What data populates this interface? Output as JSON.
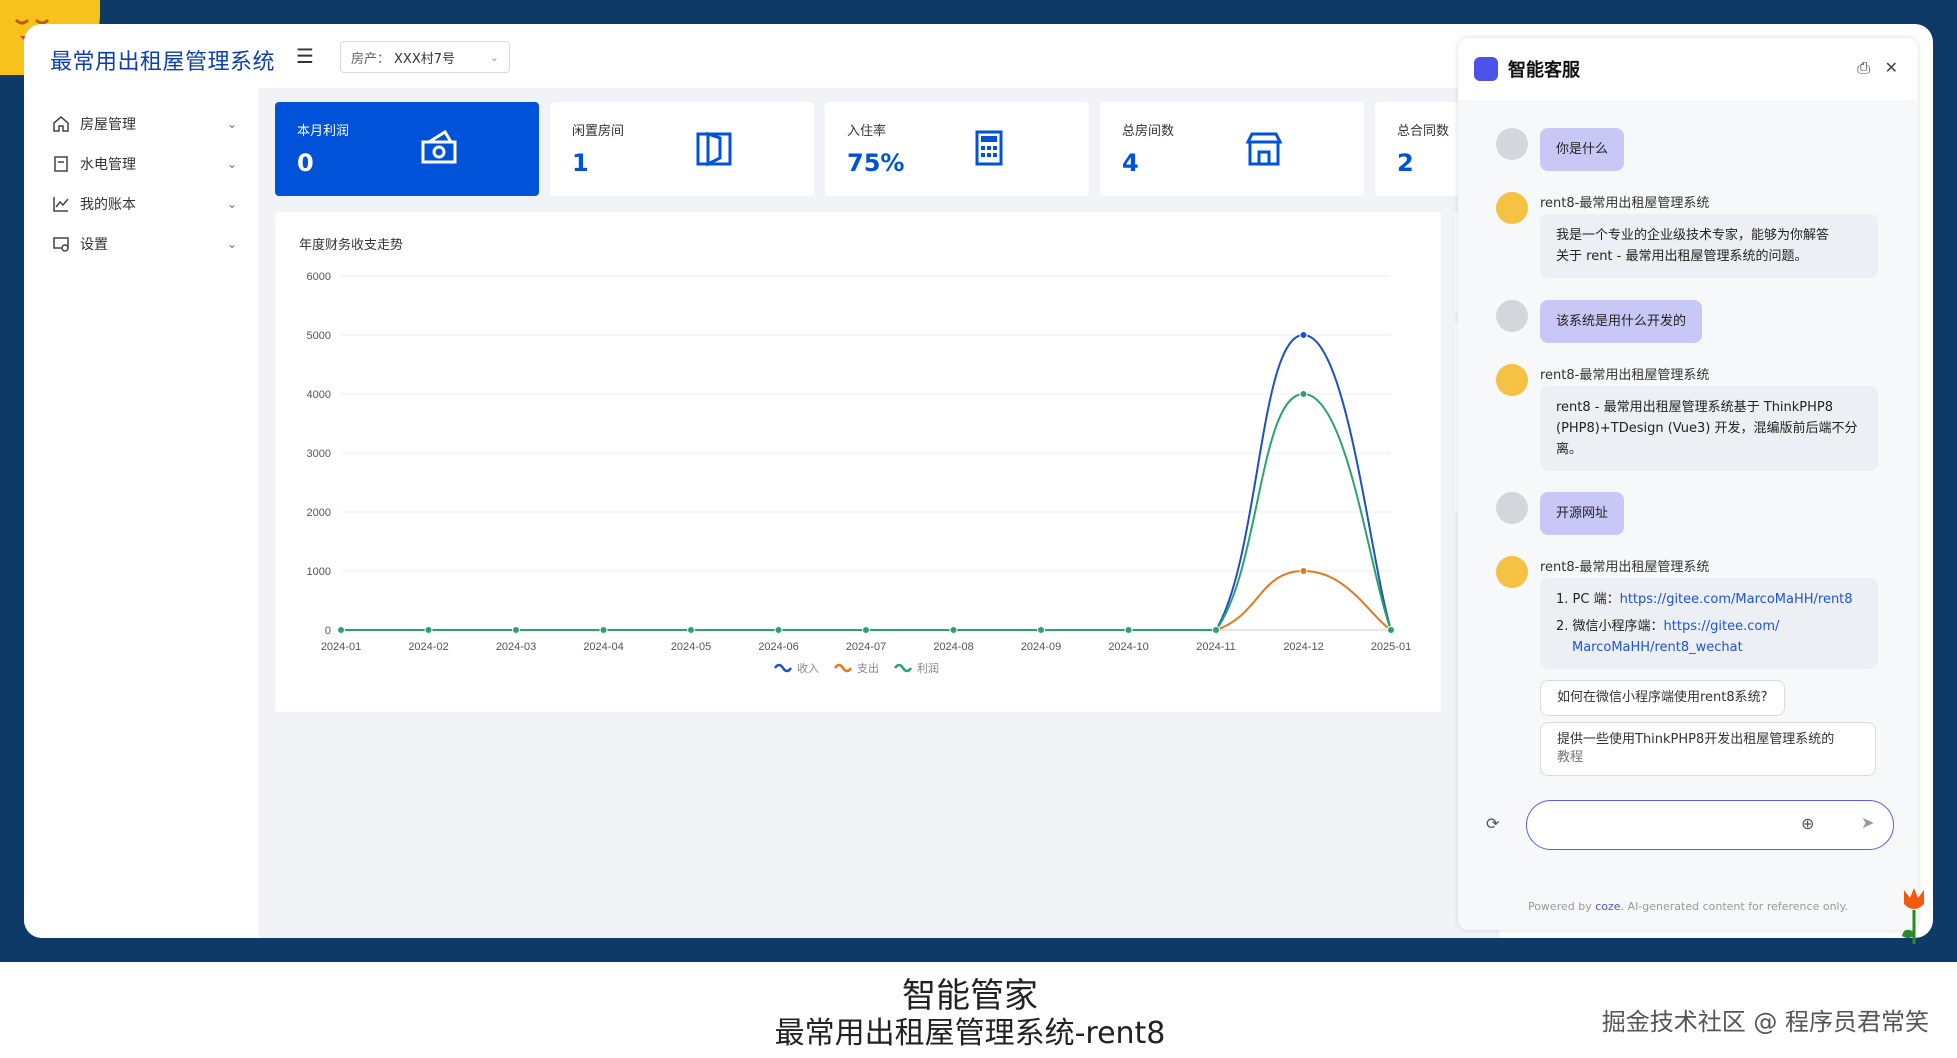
{
  "app": {
    "title": "最常用出租屋管理系统",
    "property_label": "房产：",
    "property_value": "XXX村7号"
  },
  "sidebar": {
    "items": [
      {
        "label": "房屋管理",
        "icon": "home-icon"
      },
      {
        "label": "水电管理",
        "icon": "meter-icon"
      },
      {
        "label": "我的账本",
        "icon": "chart-line-icon"
      },
      {
        "label": "设置",
        "icon": "settings-icon"
      }
    ]
  },
  "stats": [
    {
      "title": "本月利润",
      "value": "0",
      "icon": "money-icon"
    },
    {
      "title": "闲置房间",
      "value": "1",
      "icon": "door-icon"
    },
    {
      "title": "入住率",
      "value": "75%",
      "icon": "calculator-icon"
    },
    {
      "title": "总房间数",
      "value": "4",
      "icon": "store-icon"
    },
    {
      "title": "总合同数",
      "value": "2",
      "icon": "contract-icon"
    }
  ],
  "chart_data": {
    "type": "line",
    "title": "年度财务收支走势",
    "categories": [
      "2024-01",
      "2024-02",
      "2024-03",
      "2024-04",
      "2024-05",
      "2024-06",
      "2024-07",
      "2024-08",
      "2024-09",
      "2024-10",
      "2024-11",
      "2024-12",
      "2025-01"
    ],
    "series": [
      {
        "name": "收入",
        "color": "#1f4fc7",
        "values": [
          0,
          0,
          0,
          0,
          0,
          0,
          0,
          0,
          0,
          0,
          0,
          5000,
          0
        ]
      },
      {
        "name": "支出",
        "color": "#e5771f",
        "values": [
          0,
          0,
          0,
          0,
          0,
          0,
          0,
          0,
          0,
          0,
          0,
          1000,
          0
        ]
      },
      {
        "name": "利润",
        "color": "#2aa36b",
        "values": [
          0,
          0,
          0,
          0,
          0,
          0,
          0,
          0,
          0,
          0,
          0,
          4000,
          0
        ]
      }
    ],
    "ylim": [
      0,
      6000
    ],
    "yticks": [
      "0",
      "1000",
      "2000",
      "3000",
      "4000",
      "5000",
      "6000"
    ],
    "grid": true,
    "smooth": true,
    "legend": "bottom-center"
  },
  "chat": {
    "title": "智能客服",
    "bot_name": "rent8-最常用出租屋管理系统",
    "messages": [
      {
        "role": "user",
        "text": "你是什么"
      },
      {
        "role": "bot",
        "lines": [
          "我是一个专业的企业级技术专家，能够为你解答",
          "关于 rent - 最常用出租屋管理系统的问题。"
        ]
      },
      {
        "role": "user",
        "text": "该系统是用什么开发的"
      },
      {
        "role": "bot",
        "lines": [
          "rent8 - 最常用出租屋管理系统基于 ThinkPHP8",
          "(PHP8)+TDesign (Vue3) 开发，混编版前后端不分",
          "离。"
        ]
      },
      {
        "role": "user",
        "text": "开源网址"
      },
      {
        "role": "bot",
        "list": [
          {
            "prefix": "1. PC 端：",
            "link": "https://gitee.com/MarcoMaHH/rent8"
          },
          {
            "prefix": "2. 微信小程序端：",
            "link": "https://gitee.com/",
            "link2": "MarcoMaHH/rent8_wechat"
          }
        ]
      }
    ],
    "suggestions": [
      "如何在微信小程序端使用rent8系统?",
      "提供一些使用ThinkPHP8开发出租屋管理系统的",
      "教程"
    ],
    "input_value": "",
    "footer_prefix": "Powered by ",
    "footer_brand": "coze",
    "footer_suffix": ". AI-generated content for reference only."
  },
  "caption": {
    "line1": "智能管家",
    "line2": "最常用出租屋管理系统-rent8",
    "watermark": "掘金技术社区 @ 程序员君常笑"
  }
}
